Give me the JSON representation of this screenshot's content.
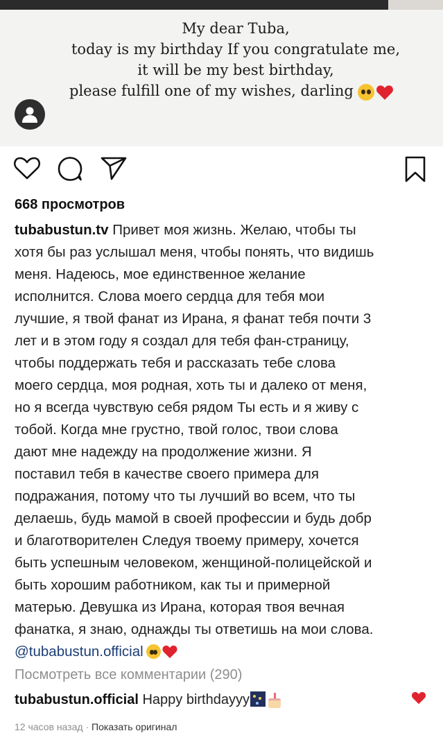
{
  "post_image": {
    "lines": [
      "My dear Tuba,",
      "today is my birthday If you congratulate me,",
      "it will be my best birthday,",
      "please  fulfill one of my wishes, darling"
    ],
    "emojis": [
      "pleading-face-icon",
      "red-heart-icon"
    ]
  },
  "actions": {
    "icons": [
      "heart-outline-icon",
      "comment-bubble-icon",
      "send-plane-icon",
      "bookmark-icon"
    ]
  },
  "views": "668 просмотров",
  "caption": {
    "username": "tubabustun.tv",
    "lines": [
      "Привет моя жизнь. Желаю, чтобы ты",
      "хотя бы раз услышал меня, чтобы понять, что видишь",
      "меня. Надеюсь, мое единственное желание",
      "исполнится. Слова моего сердца для тебя мои",
      "лучшие, я твой фанат из Ирана, я фанат тебя почти 3",
      "лет и в этом году я создал для тебя фан-страницу,",
      "чтобы поддержать тебя и рассказать тебе слова",
      "моего сердца, моя родная, хоть ты и далеко от меня,",
      "но я всегда чувствую себя рядом Ты есть и я живу с",
      "тобой. Когда мне грустно, твой голос, твои слова",
      "дают мне надежду на продолжение жизни. Я",
      "поставил тебя в качестве своего примера для",
      "подражания, потому что ты лучший во всем, что ты",
      "делаешь, будь мамой в своей профессии и будь добр",
      "и благотворителен Следуя твоему примеру, хочется",
      "быть успешным человеком, женщиной-полицейской и",
      "быть хорошим работником, как ты и примерной",
      "матерью. Девушка из Ирана, которая твоя вечная",
      "фанатка, я знаю, однажды ты ответишь на мои слова."
    ],
    "mention": "@tubabustun.official"
  },
  "view_comments": "Посмотреть все комментарии (290)",
  "comment": {
    "username": "tubabustun.official",
    "text": "Happy birthdayyy"
  },
  "meta": {
    "time": "12 часов назад",
    "separator": "·",
    "show_original": "Показать оригинал"
  },
  "colors": {
    "heart_red": "#e0242f",
    "mention_blue": "#1b3d74",
    "muted_gray": "#8e8e8e"
  }
}
